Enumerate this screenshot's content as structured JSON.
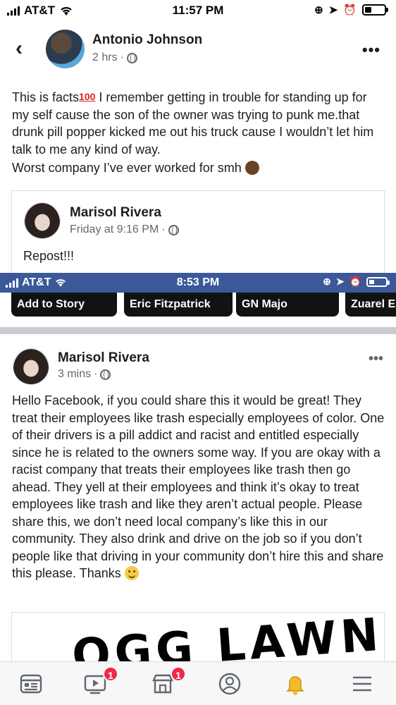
{
  "status_bar": {
    "carrier": "AT&T",
    "time": "11:57 PM"
  },
  "post": {
    "author": "Antonio Johnson",
    "time": "2 hrs",
    "text_lines": [
      "This is facts",
      "I remember getting in trouble for standing up for my self  cause the son of the owner was trying to punk me.that drunk pill popper kicked me out his truck cause I wouldn’t let him talk to me any kind of way.",
      "Worst company I’ve ever worked for smh"
    ],
    "hundred_emoji": "100"
  },
  "shared_post": {
    "author": "Marisol Rivera",
    "time": "Friday at 9:16 PM",
    "text": "Repost!!!"
  },
  "inner_screenshot": {
    "carrier": "AT&T",
    "time": "8:53 PM",
    "stories": [
      "Add to Story",
      "Eric Fitzpatrick",
      "GN Majo",
      "Zuarel E"
    ]
  },
  "original_post": {
    "author": "Marisol Rivera",
    "time": "3 mins",
    "text": "Hello Facebook, if you could share this it would be great! They treat their employees like trash especially employees of color. One of their drivers is a pill addict and racist and entitled especially since he is related to the owners some way. If you are okay with a racist company that treats their employees like trash then go ahead. They yell at their employees and think it’s okay to treat employees like trash and like they aren’t actual people. Please share this, we don’t need local company’s like this in our community.  They also drink and drive on the job so if you don’t people like that driving in your community don’t hire this and share this please. Thanks",
    "image_text": "OGG LAWN"
  },
  "tab_bar": {
    "items": [
      {
        "icon": "news-feed-icon",
        "badge": ""
      },
      {
        "icon": "watch-icon",
        "badge": "1"
      },
      {
        "icon": "marketplace-icon",
        "badge": "1"
      },
      {
        "icon": "profile-icon",
        "badge": ""
      },
      {
        "icon": "notifications-icon",
        "badge": ""
      },
      {
        "icon": "menu-icon",
        "badge": ""
      }
    ],
    "active_color": "#f7b928",
    "icon_color": "#606770"
  },
  "colors": {
    "facebook_blue": "#3b5998",
    "badge_red": "#f02849"
  }
}
